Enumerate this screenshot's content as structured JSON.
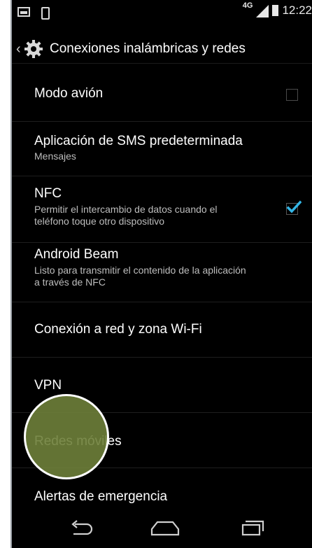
{
  "status_bar": {
    "network": "4G",
    "time": "12:22"
  },
  "action_bar": {
    "title": "Conexiones inalámbricas y redes"
  },
  "settings": [
    {
      "title": "Modo avión",
      "summary": "",
      "checkbox": false
    },
    {
      "title": "Aplicación de SMS predeterminada",
      "summary": "Mensajes"
    },
    {
      "title": "NFC",
      "summary": "Permitir el intercambio de datos cuando el teléfono toque otro dispositivo",
      "checkbox": true
    },
    {
      "title": "Android Beam",
      "summary": "Listo para transmitir el contenido de la aplicación a través de NFC"
    },
    {
      "title": "Conexión a red y zona Wi-Fi",
      "summary": ""
    },
    {
      "title": "VPN",
      "summary": ""
    },
    {
      "title": "Redes móviles",
      "summary": ""
    },
    {
      "title": "Alertas de emergencia",
      "summary": ""
    }
  ],
  "icons": {
    "gallery": "gallery-icon",
    "phone": "phone-icon",
    "signal": "signal-icon",
    "battery": "battery-icon",
    "settings": "gear-icon",
    "back": "back-icon",
    "home": "home-icon",
    "recents": "recents-icon"
  },
  "colors": {
    "background": "#000000",
    "text": "#ffffff",
    "summary": "#bdbdbd",
    "accent": "#33b5e5",
    "touch_indicator": "#6e803a"
  }
}
